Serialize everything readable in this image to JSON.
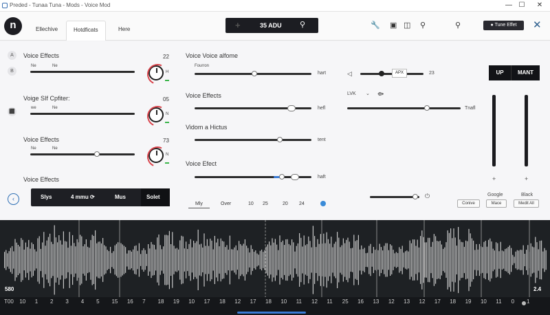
{
  "window": {
    "title": "Preded - Tunaa Tuna - Mods - Voice Mod",
    "controls": [
      "—",
      "☐",
      "✕"
    ]
  },
  "toolbar": {
    "logo": "n",
    "tabs": [
      {
        "label": "Ellechive",
        "active": false
      },
      {
        "label": "Hotdficats",
        "active": true
      },
      {
        "label": "Here",
        "active": false
      }
    ],
    "search": {
      "plus": "+",
      "value": "35 ADU",
      "icon": "search-icon"
    },
    "icons": [
      "wrench-icon",
      "instagram-icon",
      "camera-icon",
      "search-icon",
      "tool-icon"
    ],
    "tune_button": "Tune Effet",
    "close": "✕"
  },
  "left": {
    "groups": [
      {
        "title": "Voice Effects",
        "value": "22",
        "sub1": "Ne",
        "sub2": "Ne",
        "knob_letter": "H",
        "slider": 1.0
      },
      {
        "title": "Voige SIf Cpfiter:",
        "value": "05",
        "sub1": "we",
        "sub2": "Ne",
        "knob_letter": "N",
        "slider": 1.0
      },
      {
        "title": "Voice Effects",
        "value": "73",
        "sub1": "Ne",
        "sub2": "Ne",
        "knob_letter": "N",
        "slider": 0.62
      },
      {
        "title": "Voice Effects",
        "value": "",
        "sub1": "",
        "sub2": "",
        "knob_letter": "",
        "slider": null
      }
    ],
    "side_icons": [
      "A",
      "B",
      "⬛"
    ],
    "segments": [
      "Slys",
      "4 mmu ⟳",
      "Mus",
      "Solet"
    ],
    "back": "‹"
  },
  "middle": {
    "rows": [
      {
        "title": "Voice Voice alfome",
        "sub": "Fourron",
        "end": "hart",
        "pos": 0.48
      },
      {
        "title": "Voice Effects",
        "sub": "",
        "end": "hefl",
        "pos": 0.79
      },
      {
        "title": "Vidom a Hictus",
        "sub": "",
        "end": "tent",
        "pos": 0.68
      },
      {
        "title": "Voice Efect",
        "sub": "",
        "end": "haft",
        "pos": 0.82
      }
    ],
    "bottom_tabs": [
      "Mly",
      "Over",
      "10",
      "25",
      "20",
      "24"
    ]
  },
  "right": {
    "vol_value": "23",
    "vol_label": "APX",
    "mode": "LVK",
    "mode_arrow": "⌄",
    "mode_extra": "⟴",
    "wide_end": "Tnafl",
    "dual": [
      "UP",
      "MANT"
    ],
    "fader_labels": [
      "Google",
      "Black"
    ],
    "buttons": [
      "Conive",
      "Mace",
      "Medit All"
    ]
  },
  "wave": {
    "left_value": "580",
    "right_value": "2.4"
  },
  "timeline": [
    "T00",
    "10",
    "1",
    "2",
    "3",
    "4",
    "5",
    "15",
    "16",
    "7",
    "18",
    "19",
    "10",
    "17",
    "18",
    "12",
    "17",
    "18",
    "10",
    "11",
    "12",
    "11",
    "25",
    "16",
    "13",
    "12",
    "13",
    "12",
    "17",
    "18",
    "19",
    "10",
    "11",
    "0",
    "1"
  ]
}
